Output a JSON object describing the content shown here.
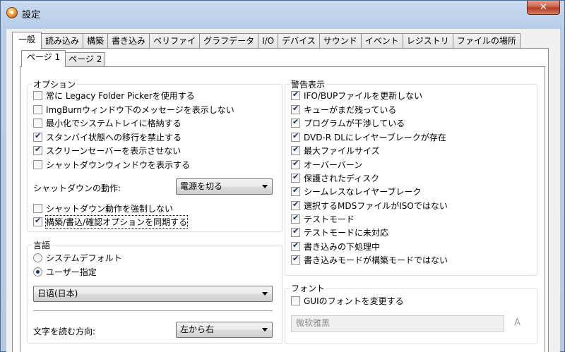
{
  "window": {
    "title": "設定",
    "close_glyph": "✕"
  },
  "main_tabs": [
    "一般",
    "読み込み",
    "構築",
    "書き込み",
    "ベリファイ",
    "グラフデータ",
    "I/O",
    "デバイス",
    "サウンド",
    "イベント",
    "レジストリ",
    "ファイルの場所"
  ],
  "active_main_tab": "一般",
  "sub_tabs": [
    "ページ 1",
    "ページ 2"
  ],
  "active_sub_tab": "ページ 1",
  "options": {
    "title": "オプション",
    "checkboxes": [
      {
        "label": "常に Legacy Folder Pickerを使用する",
        "checked": false
      },
      {
        "label": "ImgBurnウィンドウ下のメッセージを表示しない",
        "checked": false
      },
      {
        "label": "最小化でシステムトレイに格納する",
        "checked": false
      },
      {
        "label": "スタンバイ状態への移行を禁止する",
        "checked": true
      },
      {
        "label": "スクリーンセーバーを表示させない",
        "checked": true
      },
      {
        "label": "シャットダウンウィンドウを表示する",
        "checked": false
      }
    ],
    "shutdown_action_label": "シャットダウンの動作:",
    "shutdown_action_value": "電源を切る",
    "force_shutdown": {
      "label": "シャットダウン動作を強制しない",
      "checked": false
    },
    "sync_options": {
      "label": "構築/書込/確認オプションを同期する",
      "checked": true
    }
  },
  "language": {
    "title": "言語",
    "radios": [
      {
        "label": "システムデフォルト",
        "checked": false
      },
      {
        "label": "ユーザー指定",
        "checked": true
      }
    ],
    "language_value": "日语(日本)",
    "reading_direction_label": "文字を読む方向:",
    "reading_direction_value": "左から右"
  },
  "warnings": {
    "title": "警告表示",
    "checkboxes": [
      {
        "label": "IFO/BUPファイルを更新しない",
        "checked": true
      },
      {
        "label": "キューがまだ残っている",
        "checked": true
      },
      {
        "label": "プログラムが干渉している",
        "checked": true
      },
      {
        "label": "DVD-R DLにレイヤーブレークが存在",
        "checked": true
      },
      {
        "label": "最大ファイルサイズ",
        "checked": true
      },
      {
        "label": "オーバーバーン",
        "checked": true
      },
      {
        "label": "保護されたディスク",
        "checked": true
      },
      {
        "label": "シームレスなレイヤーブレーク",
        "checked": true
      },
      {
        "label": "選択するMDSファイルがISOではない",
        "checked": true
      },
      {
        "label": "テストモード",
        "checked": true
      },
      {
        "label": "テストモードに未対応",
        "checked": true
      },
      {
        "label": "書き込みの下処理中",
        "checked": true
      },
      {
        "label": "書き込みモードが構築モードではない",
        "checked": true
      }
    ]
  },
  "font": {
    "title": "フォント",
    "change_gui_font": {
      "label": "GUIのフォントを変更する",
      "checked": false
    },
    "font_name_value": "微软雅黑",
    "font_icon_glyph": "A"
  }
}
